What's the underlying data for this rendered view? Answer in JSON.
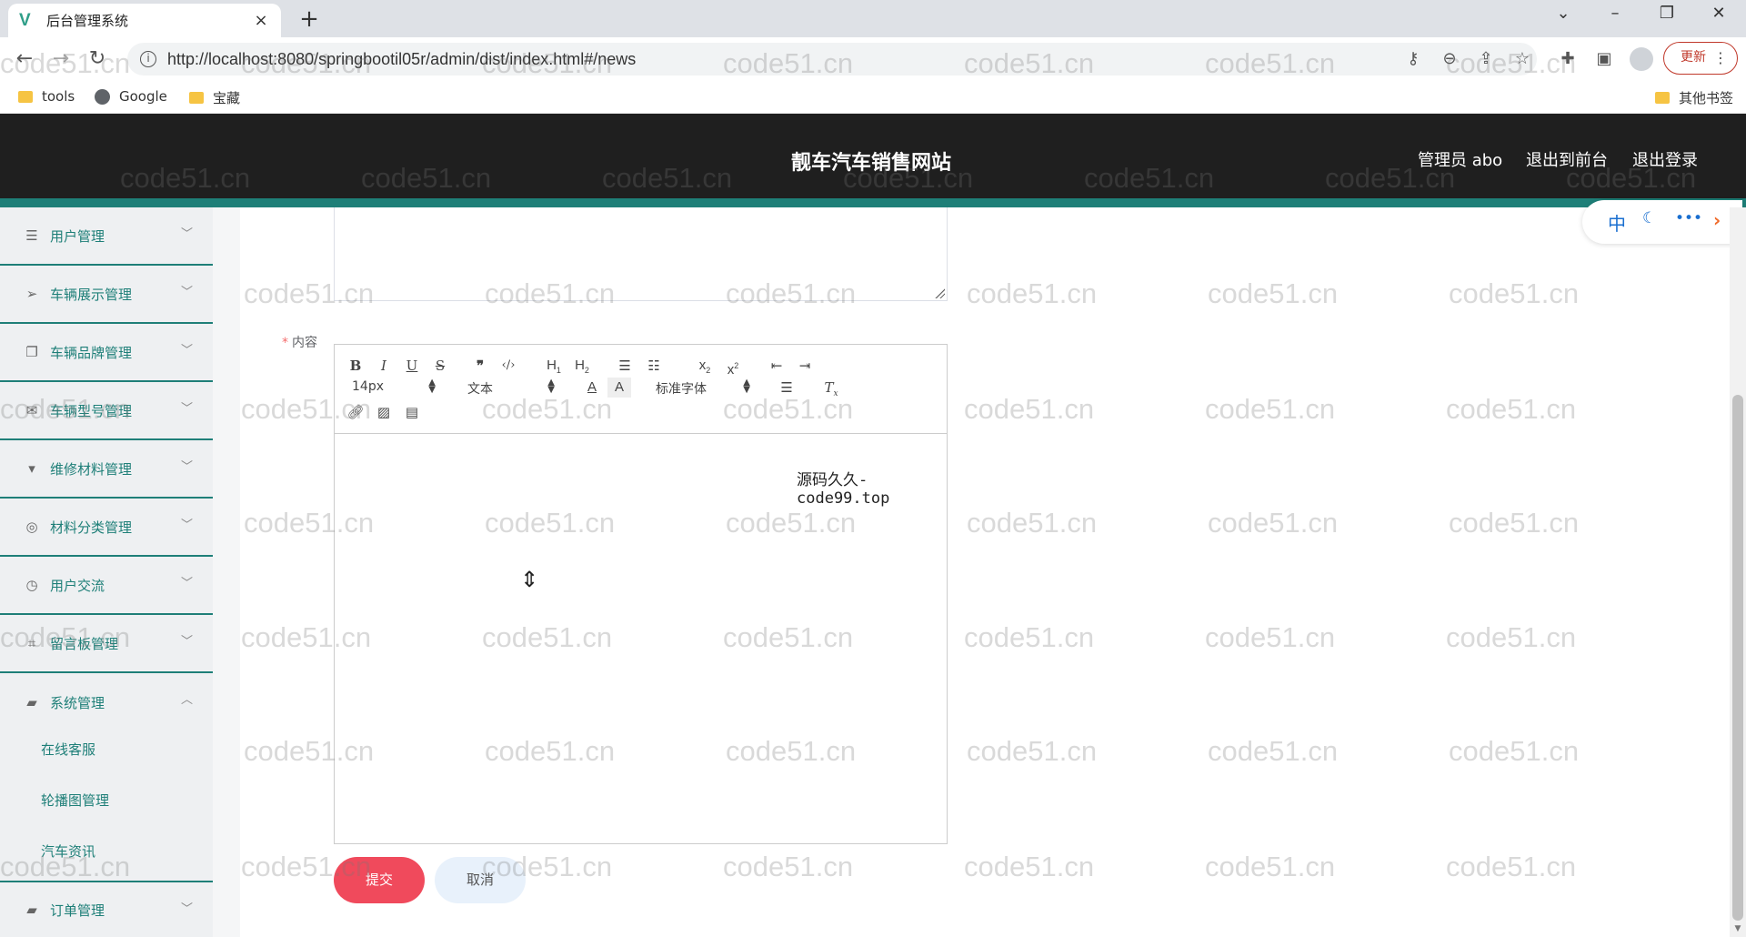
{
  "browser": {
    "tab_title": "后台管理系统",
    "tab_close": "×",
    "new_tab": "+",
    "url": "http://localhost:8080/springbootil05r/admin/dist/index.html#/news",
    "update_label": "更新",
    "bookmarks": [
      "tools",
      "Google",
      "宝藏"
    ],
    "other_bookmarks": "其他书签"
  },
  "header": {
    "title": "靓车汽车销售网站",
    "user": "管理员 abo",
    "to_front": "退出到前台",
    "logout": "退出登录"
  },
  "sidebar": {
    "items": [
      {
        "label": "用户管理",
        "icon": "list-icon"
      },
      {
        "label": "车辆展示管理",
        "icon": "send-icon"
      },
      {
        "label": "车辆品牌管理",
        "icon": "copy-icon"
      },
      {
        "label": "车辆型号管理",
        "icon": "mail-icon"
      },
      {
        "label": "维修材料管理",
        "icon": "cup-icon"
      },
      {
        "label": "材料分类管理",
        "icon": "compass-icon"
      },
      {
        "label": "用户交流",
        "icon": "clock-icon"
      },
      {
        "label": "留言板管理",
        "icon": "crop-icon"
      },
      {
        "label": "系统管理",
        "icon": "chat-icon"
      },
      {
        "label": "订单管理",
        "icon": "chat-icon"
      }
    ],
    "sub_items": [
      "在线客服",
      "轮播图管理",
      "汽车资讯"
    ]
  },
  "form": {
    "content_label": "内容",
    "required_mark": "*",
    "submit": "提交",
    "cancel": "取消"
  },
  "editor": {
    "font_size": "14px",
    "header_select": "文本",
    "font_family": "标准字体",
    "body_text": "源码久久-code99.top"
  },
  "widget": {
    "lang": "中"
  },
  "watermark": "code51.cn"
}
